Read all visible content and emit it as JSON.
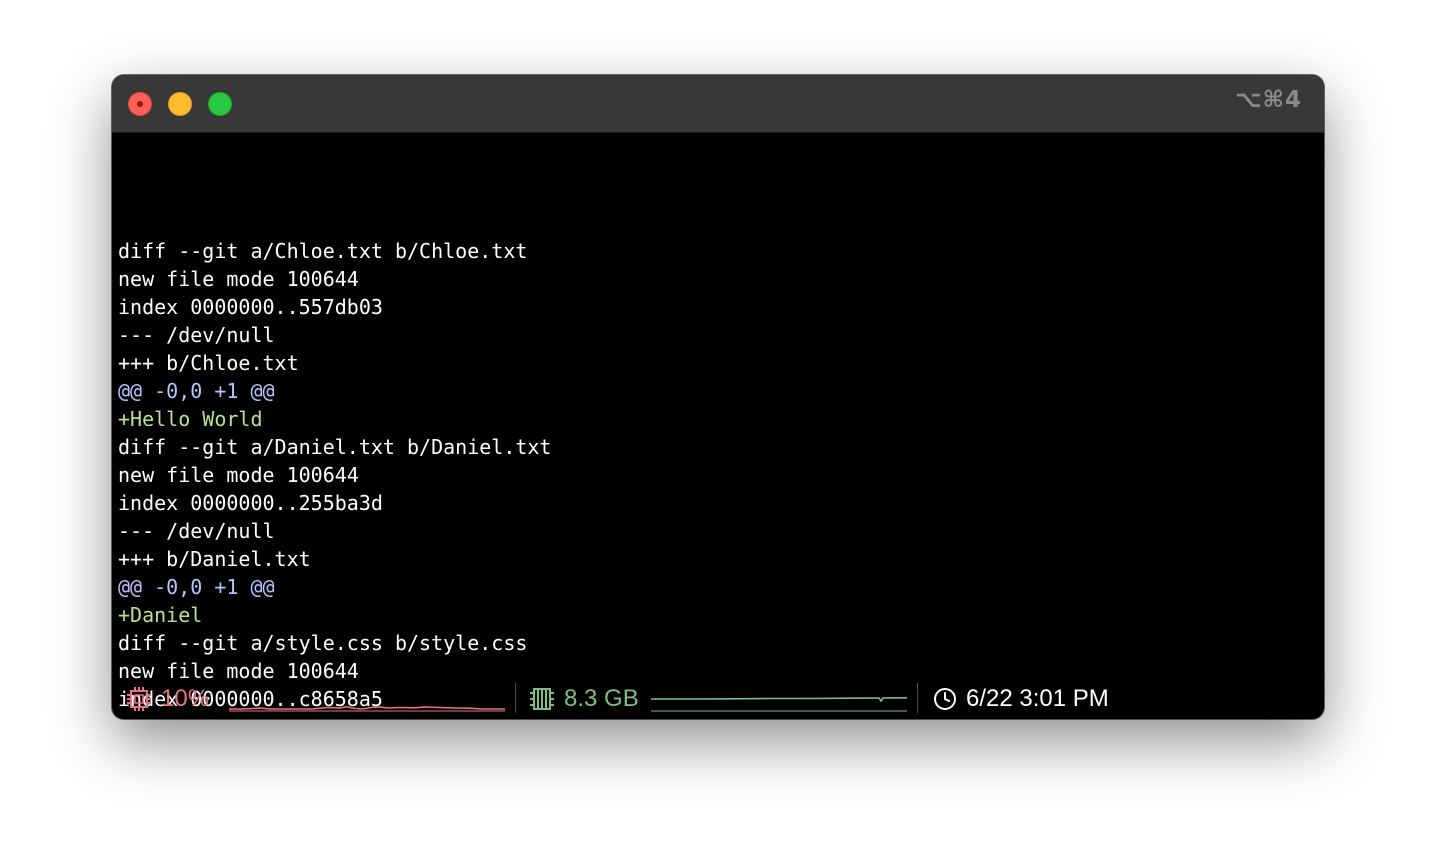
{
  "window": {
    "shortcut": "⌥⌘4"
  },
  "terminal": {
    "lines": [
      {
        "text": "diff --git a/Chloe.txt b/Chloe.txt",
        "kind": "meta"
      },
      {
        "text": "new file mode 100644",
        "kind": "meta"
      },
      {
        "text": "index 0000000..557db03",
        "kind": "meta"
      },
      {
        "text": "--- /dev/null",
        "kind": "meta"
      },
      {
        "text": "+++ b/Chloe.txt",
        "kind": "meta"
      },
      {
        "text": "@@ -0,0 +1 @@",
        "kind": "hunk"
      },
      {
        "text": "+Hello World",
        "kind": "add"
      },
      {
        "text": "diff --git a/Daniel.txt b/Daniel.txt",
        "kind": "meta"
      },
      {
        "text": "new file mode 100644",
        "kind": "meta"
      },
      {
        "text": "index 0000000..255ba3d",
        "kind": "meta"
      },
      {
        "text": "--- /dev/null",
        "kind": "meta"
      },
      {
        "text": "+++ b/Daniel.txt",
        "kind": "meta"
      },
      {
        "text": "@@ -0,0 +1 @@",
        "kind": "hunk"
      },
      {
        "text": "+Daniel",
        "kind": "add"
      },
      {
        "text": "diff --git a/style.css b/style.css",
        "kind": "meta"
      },
      {
        "text": "new file mode 100644",
        "kind": "meta"
      },
      {
        "text": "index 0000000..c8658a5",
        "kind": "meta"
      }
    ],
    "prompt": ":"
  },
  "status": {
    "cpu": {
      "label": "10%",
      "icon": "cpu-icon",
      "color": "#e8737f"
    },
    "memory": {
      "label": "8.3 GB",
      "icon": "memory-icon",
      "color": "#7bbf85"
    },
    "clock": {
      "label": "6/22 3:01 PM",
      "icon": "clock-icon",
      "color": "#ffffff"
    }
  },
  "colors": {
    "titlebar": "#383838",
    "terminal_bg": "#000000",
    "hunk": "#b9c3ff",
    "added": "#b8e38c",
    "cursor": "#f5a15a"
  }
}
